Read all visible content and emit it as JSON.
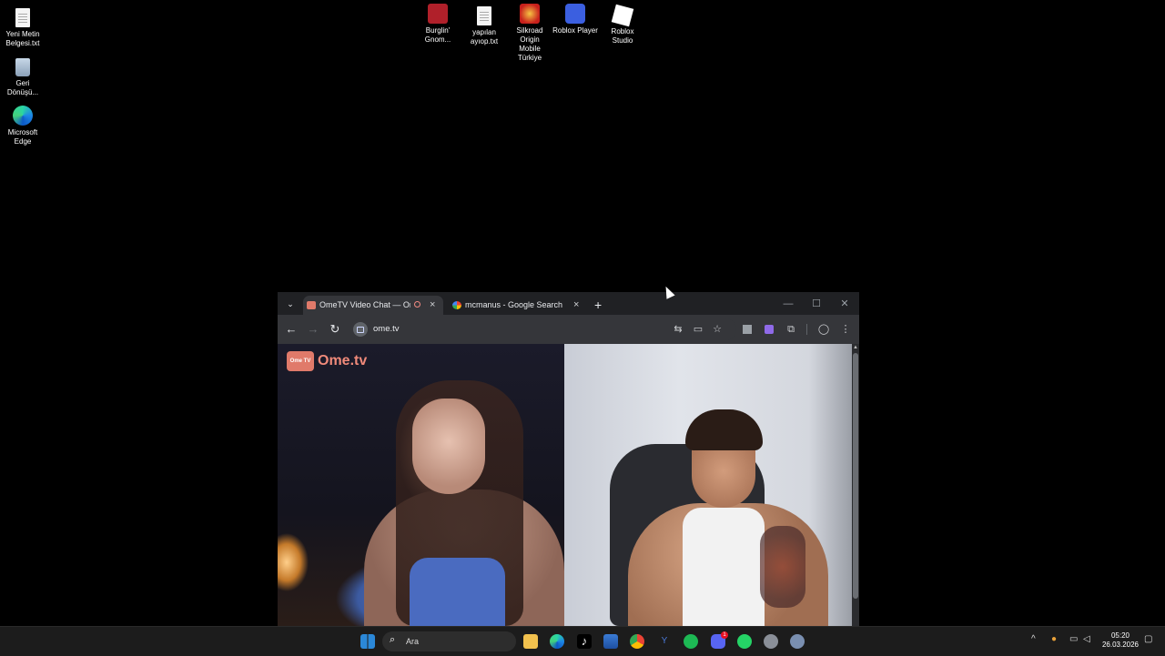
{
  "desktop": {
    "icons": [
      {
        "label": "Yeni Metin\nBelgesi.txt"
      },
      {
        "label": "Geri\nDönüşü..."
      },
      {
        "label": "Microsoft\nEdge"
      },
      {
        "label": "Burglin'\nGnom..."
      },
      {
        "label": "yapılan\nayıop.txt"
      },
      {
        "label": "Silkroad\nOrigin\nMobile\nTürkiye"
      },
      {
        "label": "Roblox Player"
      },
      {
        "label": "Roblox\nStudio"
      }
    ]
  },
  "browser": {
    "tabs": [
      {
        "title": "OmeTV Video Chat — Ome"
      },
      {
        "title": "mcmanus - Google Search"
      }
    ],
    "new_tab": "+",
    "address": "ome.tv",
    "window_controls": {
      "minimize": "—",
      "maximize": "☐",
      "close": "✕"
    }
  },
  "ometv": {
    "logo_box": "Ome TV",
    "logo_text": "Ome.tv"
  },
  "taskbar": {
    "search_placeholder": "Ara",
    "time": "05:20",
    "date": "26.03.2026",
    "discord_badge": "1"
  },
  "colors": {
    "spotify": "#1db954",
    "chrome_blue": "#4285f4",
    "windows_blue": "#2b88d8"
  }
}
